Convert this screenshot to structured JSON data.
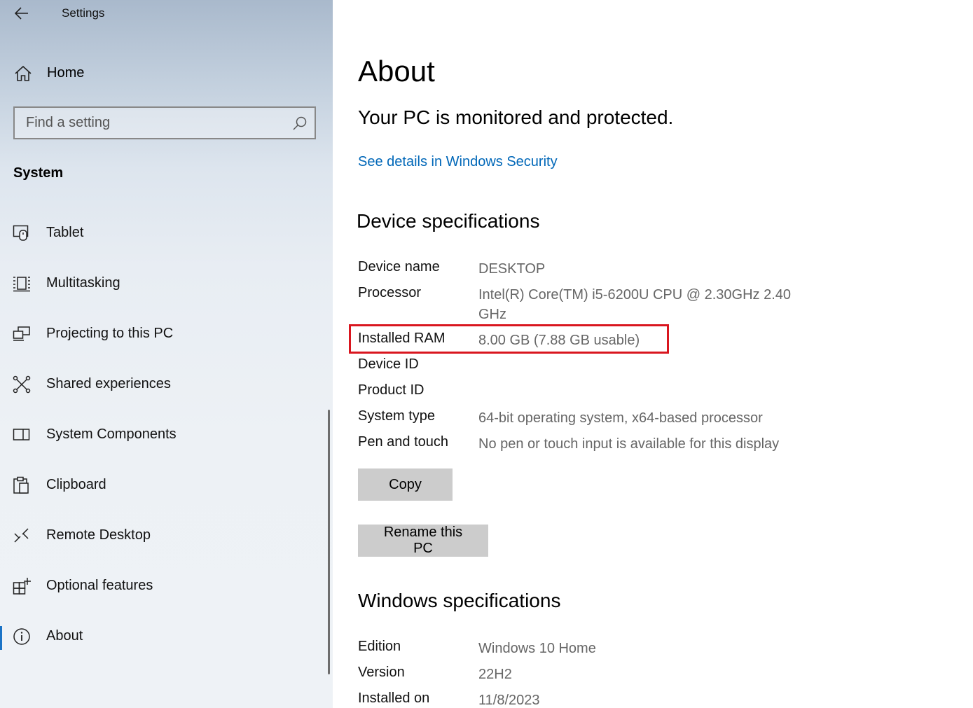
{
  "window": {
    "app_title": "Settings"
  },
  "sidebar": {
    "home_label": "Home",
    "search_placeholder": "Find a setting",
    "section_heading": "System",
    "items": [
      {
        "label": "Tablet",
        "icon": "tablet-icon"
      },
      {
        "label": "Multitasking",
        "icon": "multitasking-icon"
      },
      {
        "label": "Projecting to this PC",
        "icon": "projecting-icon"
      },
      {
        "label": "Shared experiences",
        "icon": "shared-experiences-icon"
      },
      {
        "label": "System Components",
        "icon": "system-components-icon"
      },
      {
        "label": "Clipboard",
        "icon": "clipboard-icon"
      },
      {
        "label": "Remote Desktop",
        "icon": "remote-desktop-icon"
      },
      {
        "label": "Optional features",
        "icon": "optional-features-icon"
      },
      {
        "label": "About",
        "icon": "info-icon",
        "selected": true
      }
    ]
  },
  "main": {
    "page_title": "About",
    "protection_status": "Your PC is monitored and protected.",
    "security_link": "See details in Windows Security",
    "device_spec_heading": "Device specifications",
    "device_specs": [
      {
        "label": "Device name",
        "value": "DESKTOP"
      },
      {
        "label": "Processor",
        "value": "Intel(R) Core(TM) i5-6200U CPU @ 2.30GHz   2.40 GHz"
      },
      {
        "label": "Installed RAM",
        "value": "8.00 GB (7.88 GB usable)"
      },
      {
        "label": "Device ID",
        "value": ""
      },
      {
        "label": "Product ID",
        "value": ""
      },
      {
        "label": "System type",
        "value": "64-bit operating system, x64-based processor"
      },
      {
        "label": "Pen and touch",
        "value": "No pen or touch input is available for this display"
      }
    ],
    "copy_button": "Copy",
    "rename_button": "Rename this PC",
    "windows_spec_heading": "Windows specifications",
    "windows_specs": [
      {
        "label": "Edition",
        "value": "Windows 10 Home"
      },
      {
        "label": "Version",
        "value": "22H2"
      },
      {
        "label": "Installed on",
        "value": "11/8/2023"
      }
    ]
  },
  "colors": {
    "link": "#0067b8",
    "highlight_border": "#d9161f",
    "selected_indicator": "#1a73c6",
    "button_bg": "#cccccc"
  }
}
